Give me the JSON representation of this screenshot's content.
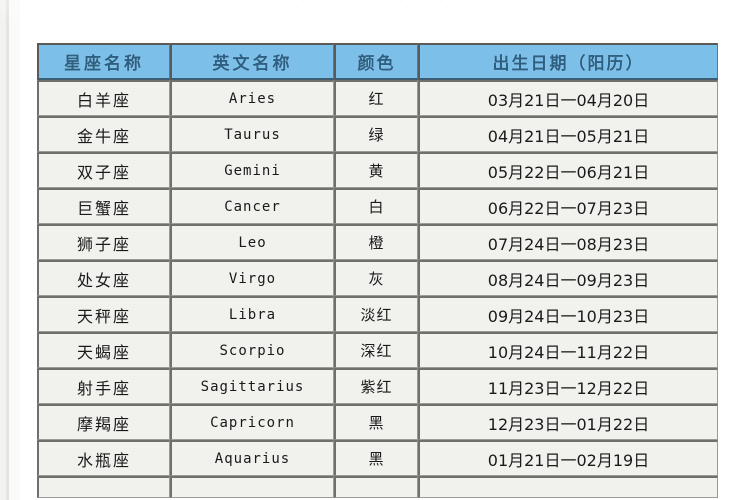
{
  "page": {
    "ghost_top_text": "· · ·   · ·   · · ·"
  },
  "table": {
    "headers": {
      "name": "星座名称",
      "english": "英文名称",
      "color": "颜色",
      "date": "出生日期（阳历）"
    },
    "rows": [
      {
        "name": "白羊座",
        "english": "Aries",
        "color": "红",
        "date": "03月21日一04月20日"
      },
      {
        "name": "金牛座",
        "english": "Taurus",
        "color": "绿",
        "date": "04月21日一05月21日"
      },
      {
        "name": "双子座",
        "english": "Gemini",
        "color": "黄",
        "date": "05月22日一06月21日"
      },
      {
        "name": "巨蟹座",
        "english": "Cancer",
        "color": "白",
        "date": "06月22日一07月23日"
      },
      {
        "name": "狮子座",
        "english": "Leo",
        "color": "橙",
        "date": "07月24日一08月23日"
      },
      {
        "name": "处女座",
        "english": "Virgo",
        "color": "灰",
        "date": "08月24日一09月23日"
      },
      {
        "name": "天秤座",
        "english": "Libra",
        "color": "淡红",
        "date": "09月24日一10月23日"
      },
      {
        "name": "天蝎座",
        "english": "Scorpio",
        "color": "深红",
        "date": "10月24日一11月22日"
      },
      {
        "name": "射手座",
        "english": "Sagittarius",
        "color": "紫红",
        "date": "11月23日一12月22日"
      },
      {
        "name": "摩羯座",
        "english": "Capricorn",
        "color": "黑",
        "date": "12月23日一01月22日"
      },
      {
        "name": "水瓶座",
        "english": "Aquarius",
        "color": "黑",
        "date": "01月21日一02月19日"
      }
    ]
  },
  "colors": {
    "header_background": "#7cc0ea",
    "header_text": "#2e5f80",
    "cell_background": "#f1f2ee",
    "cell_text": "#1a1a1a",
    "grid_line": "#6f706c",
    "page_background": "#ffffff"
  }
}
